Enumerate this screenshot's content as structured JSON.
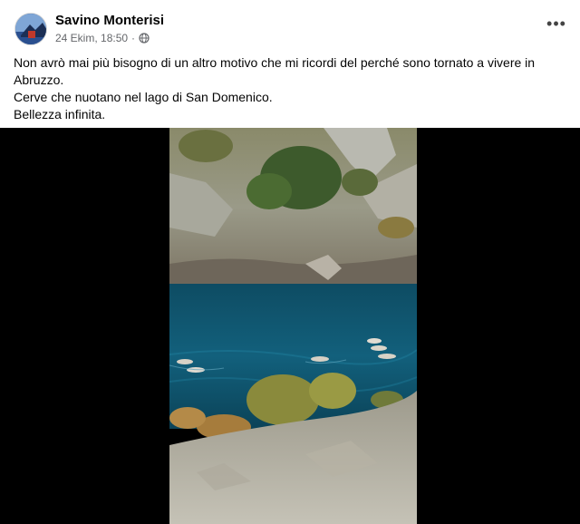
{
  "post": {
    "author": "Savino Monterisi",
    "timestamp": "24 Ekim, 18:50",
    "separator": "·",
    "audience_icon": "globe-icon",
    "more_icon": "more-options-icon",
    "more_glyph": "•••",
    "text_lines": [
      "Non avrò mai più bisogno di un altro motivo che mi ricordi del perché sono tornato a vivere in Abruzzo.",
      "Cerve che nuotano nel lago di San Domenico.",
      "Bellezza infinita."
    ]
  },
  "colors": {
    "author": "#050505",
    "meta": "#65676b",
    "media_background": "#000000",
    "lake": "#0f5f7c"
  }
}
